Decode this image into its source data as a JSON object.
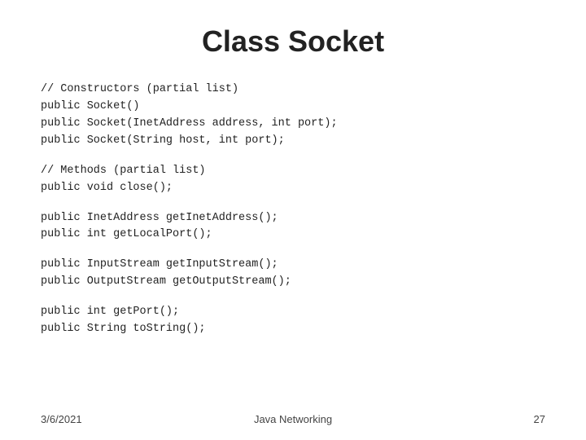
{
  "slide": {
    "title": "Class Socket",
    "code_sections": [
      {
        "id": "constructors",
        "lines": [
          "// Constructors (partial list)",
          "public Socket()",
          "public Socket(InetAddress address, int port);",
          "public Socket(String host, int port);"
        ]
      },
      {
        "id": "methods-close",
        "lines": [
          "// Methods (partial list)",
          "public void close();"
        ]
      },
      {
        "id": "methods-address",
        "lines": [
          "public InetAddress getInetAddress();",
          "public int getLocalPort();"
        ]
      },
      {
        "id": "methods-streams",
        "lines": [
          "public InputStream getInputStream();",
          "public OutputStream getOutputStream();"
        ]
      },
      {
        "id": "methods-port",
        "lines": [
          "public int getPort();",
          "public String toString();"
        ]
      }
    ],
    "footer": {
      "left": "3/6/2021",
      "center": "Java Networking",
      "right": "27"
    }
  }
}
